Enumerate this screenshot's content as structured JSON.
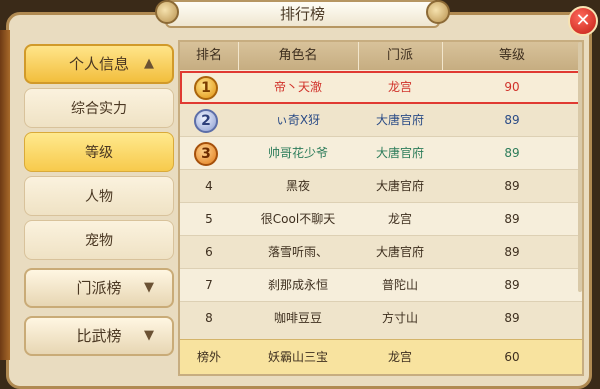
{
  "title": "排行榜",
  "close_label": "✕",
  "sidebar": {
    "group_personal": "个人信息",
    "sub_items": [
      "综合实力",
      "等级",
      "人物",
      "宠物"
    ],
    "selected": "等级",
    "group_school": "门派榜",
    "group_pvp": "比武榜"
  },
  "table": {
    "headers": [
      "排名",
      "角色名",
      "门派",
      "等级"
    ],
    "rows": [
      {
        "rank": "1",
        "name": "帝丶天澈",
        "sect": "龙宫",
        "level": "90"
      },
      {
        "rank": "2",
        "name": "ぃ奇Ⅹ犽",
        "sect": "大唐官府",
        "level": "89"
      },
      {
        "rank": "3",
        "name": "帅哥花少爷",
        "sect": "大唐官府",
        "level": "89"
      },
      {
        "rank": "4",
        "name": "黑夜",
        "sect": "大唐官府",
        "level": "89"
      },
      {
        "rank": "5",
        "name": "很Cool不聊天",
        "sect": "龙宫",
        "level": "89"
      },
      {
        "rank": "6",
        "name": "落雪听雨、",
        "sect": "大唐官府",
        "level": "89"
      },
      {
        "rank": "7",
        "name": "刹那成永恒",
        "sect": "普陀山",
        "level": "89"
      },
      {
        "rank": "8",
        "name": "咖啡豆豆",
        "sect": "方寸山",
        "level": "89"
      }
    ],
    "footer": {
      "rank": "榜外",
      "name": "妖霸山三宝",
      "sect": "龙宫",
      "level": "60"
    }
  }
}
